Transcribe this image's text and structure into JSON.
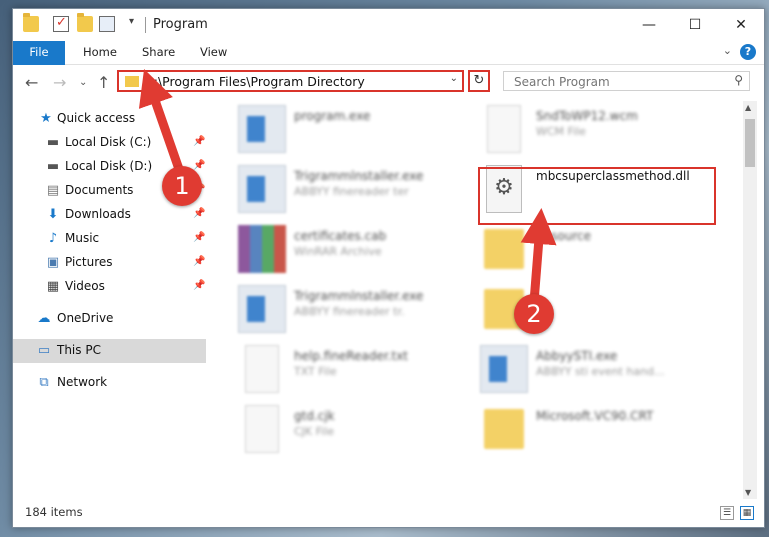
{
  "window": {
    "title": "Program"
  },
  "ribbon": {
    "tabs": [
      "File",
      "Home",
      "Share",
      "View"
    ]
  },
  "address": {
    "path": "C:\\Program Files\\Program Directory"
  },
  "search": {
    "placeholder": "Search Program"
  },
  "sidebar": {
    "items": [
      {
        "label": "Quick access",
        "icon": "star-icon"
      },
      {
        "label": "Local Disk (C:)",
        "icon": "drive-icon",
        "pinned": true
      },
      {
        "label": "Local Disk (D:)",
        "icon": "drive-icon",
        "pinned": true
      },
      {
        "label": "Documents",
        "icon": "documents-icon",
        "pinned": true
      },
      {
        "label": "Downloads",
        "icon": "download-icon",
        "pinned": true
      },
      {
        "label": "Music",
        "icon": "music-icon",
        "pinned": true
      },
      {
        "label": "Pictures",
        "icon": "pictures-icon",
        "pinned": true
      },
      {
        "label": "Videos",
        "icon": "videos-icon",
        "pinned": true
      },
      {
        "label": "OneDrive",
        "icon": "cloud-icon"
      },
      {
        "label": "This PC",
        "icon": "computer-icon",
        "selected": true
      },
      {
        "label": "Network",
        "icon": "network-icon"
      }
    ]
  },
  "files": [
    {
      "name": "program.exe",
      "type": ""
    },
    {
      "name": "SndToWP12.wcm",
      "type": "WCM File"
    },
    {
      "name": "Trigrammlnstaller.exe",
      "type": "ABBYY finereader ter"
    },
    {
      "name": "mbcsuperclassmethod.dll",
      "type": ""
    },
    {
      "name": "certificates.cab",
      "type": "WinRAR Archive"
    },
    {
      "name": "Resource",
      "type": ""
    },
    {
      "name": "Trigrammlnstaller.exe",
      "type": "ABBYY finereader tr."
    },
    {
      "name": "",
      "type": ""
    },
    {
      "name": "help.fineReader.txt",
      "type": "TXT File"
    },
    {
      "name": "AbbyySTI.exe",
      "type": "ABBYY sti event hand..."
    },
    {
      "name": "gtd.cjk",
      "type": "CJK File"
    },
    {
      "name": "Microsoft.VC90.CRT",
      "type": ""
    }
  ],
  "status": {
    "count": "184 items"
  },
  "callouts": [
    "1",
    "2"
  ],
  "colors": {
    "accent": "#1979ca",
    "highlight": "#d9342b"
  }
}
